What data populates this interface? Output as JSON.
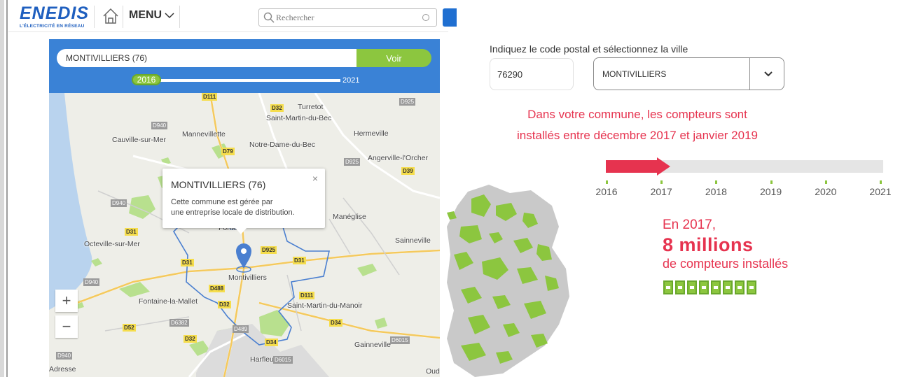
{
  "brand": {
    "name": "ENEDIS",
    "tagline": "L'ÉLECTRICITÉ EN RÉSEAU",
    "primary_color": "#1f5fbf",
    "accent_green": "#8cc63f",
    "accent_red": "#e6334f"
  },
  "header": {
    "menu_label": "MENU",
    "search_placeholder": "Rechercher"
  },
  "map_panel": {
    "commune_value": "MONTIVILLIERS (76)",
    "voir_label": "Voir",
    "year_start": "2016",
    "year_end": "2021",
    "popup": {
      "title": "MONTIVILLIERS (76)",
      "close": "×",
      "text_line1": "Cette commune est gérée par",
      "text_line2": "une entreprise locale de distribution."
    },
    "zoom_in": "+",
    "zoom_out": "−",
    "places": [
      "Turretot",
      "Saint-Martin-du-Bec",
      "Mannevillette",
      "Hermeville",
      "Cauville-sur-Mer",
      "Notre-Dame-du-Bec",
      "Angerville-l'Orcher",
      "Manéglise",
      "Octeville-sur-Mer",
      "Sainneville",
      "Montivilliers",
      "Fontaine-la-Mallet",
      "Saint-Martin-du-Manoir",
      "Gainneville",
      "Harfleur",
      "Adresse",
      "Oud",
      "Fonte"
    ],
    "roads": [
      "D111",
      "D32",
      "D925",
      "D940",
      "D79",
      "D925",
      "D39",
      "D940",
      "D31",
      "D925",
      "D31",
      "D31",
      "D940",
      "D488",
      "D111",
      "D32",
      "D6382",
      "D34",
      "D6015",
      "D52",
      "D32",
      "D34",
      "D940",
      "D6015",
      "D489"
    ]
  },
  "right_panel": {
    "prompt": "Indiquez le code postal et sélectionnez la ville",
    "postal_code": "76290",
    "city": "MONTIVILLIERS",
    "headline_line1": "Dans votre commune, les compteurs sont",
    "headline_line2": "installés entre décembre 2017 et janvier 2019",
    "timeline_years": [
      "2016",
      "2017",
      "2018",
      "2019",
      "2020",
      "2021"
    ],
    "timeline_progress_year": "2017",
    "stat_line1": "En 2017,",
    "stat_big": "8 millions",
    "stat_line3": "de compteurs installés",
    "meter_count": 8
  }
}
